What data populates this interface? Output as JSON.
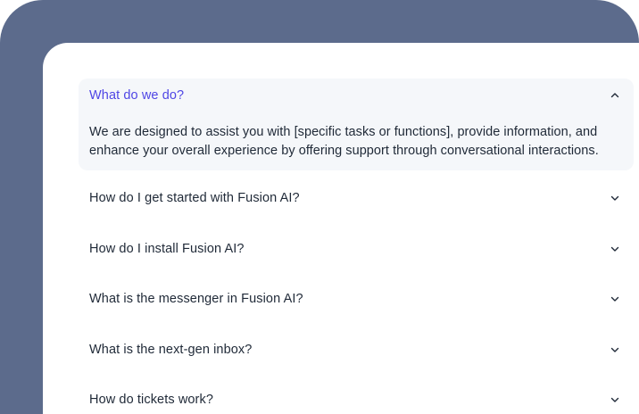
{
  "faq": {
    "items": [
      {
        "question": "What do we do?",
        "answer": "We are designed to assist you with [specific tasks or functions], provide information, and enhance your overall experience by offering support through conversational interactions.",
        "expanded": true
      },
      {
        "question": "How do I get started with Fusion AI?",
        "expanded": false
      },
      {
        "question": "How do I install Fusion AI?",
        "expanded": false
      },
      {
        "question": "What is the messenger in Fusion AI?",
        "expanded": false
      },
      {
        "question": "What is the next-gen inbox?",
        "expanded": false
      },
      {
        "question": "How do tickets work?",
        "expanded": false
      }
    ]
  },
  "colors": {
    "frame_background": "#5c6b8c",
    "card_background": "#ffffff",
    "open_item_background": "#f5f7fa",
    "accent": "#4f46e5",
    "text": "#1f2937"
  },
  "icons": {
    "expanded": "chevron-up-icon",
    "collapsed": "chevron-down-icon"
  }
}
